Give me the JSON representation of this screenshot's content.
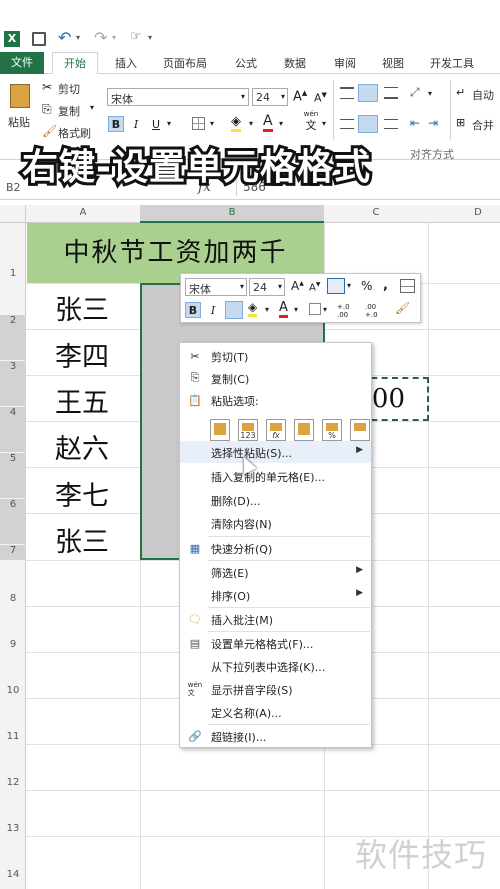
{
  "quick_access": {
    "excel_icon": "excel-logo-icon",
    "save": "save-icon",
    "undo": "undo-icon",
    "redo": "redo-icon",
    "touch": "touch-mode-icon"
  },
  "tabs": [
    {
      "label": "文件"
    },
    {
      "label": "开始"
    },
    {
      "label": "插入"
    },
    {
      "label": "页面布局"
    },
    {
      "label": "公式"
    },
    {
      "label": "数据"
    },
    {
      "label": "审阅"
    },
    {
      "label": "视图"
    },
    {
      "label": "开发工具"
    }
  ],
  "ribbon": {
    "paste": "粘贴",
    "cut": "剪切",
    "copy": "复制",
    "format_painter": "格式刷",
    "font_name": "宋体",
    "font_size": "24",
    "bold": "B",
    "italic": "I",
    "underline": "U",
    "font_color_glyph": "A",
    "wen": "wén",
    "wen_char": "文",
    "auto_wrap": "自动",
    "merge": "合并",
    "align_group": "对齐方式"
  },
  "overlay_title": "右键-设置单元格格式",
  "formula_bar": {
    "name_box": "B2",
    "fx": "fx",
    "value": "586"
  },
  "columns": [
    "A",
    "B",
    "C",
    "D"
  ],
  "rows": [
    "1",
    "2",
    "3",
    "4",
    "5",
    "6",
    "7",
    "8",
    "9",
    "10",
    "11",
    "12",
    "13",
    "14"
  ],
  "sheet": {
    "header": "中秋节工资加两千",
    "names": [
      "张三",
      "李四",
      "王五",
      "赵六",
      "李七",
      "张三"
    ],
    "c4_value": "2000"
  },
  "mini_toolbar": {
    "font_name": "宋体",
    "font_size": "24",
    "percent": "%",
    "comma": ",",
    "dec_inc": "+.0 .00",
    "dec_dec": ".00 +.0"
  },
  "context_menu": [
    {
      "label": "剪切(T)",
      "icon": "scissors-icon"
    },
    {
      "label": "复制(C)",
      "icon": "copy-icon"
    },
    {
      "label": "粘贴选项:",
      "icon": "clipboard-icon"
    },
    {
      "label": "选择性粘贴(S)...",
      "icon": "",
      "submenu": true
    },
    {
      "label": "插入复制的单元格(E)...",
      "icon": ""
    },
    {
      "label": "删除(D)...",
      "icon": ""
    },
    {
      "label": "清除内容(N)",
      "icon": ""
    },
    {
      "label": "快速分析(Q)",
      "icon": "quick-analysis-icon"
    },
    {
      "label": "筛选(E)",
      "icon": "",
      "submenu": true
    },
    {
      "label": "排序(O)",
      "icon": "",
      "submenu": true
    },
    {
      "label": "插入批注(M)",
      "icon": "comment-icon"
    },
    {
      "label": "设置单元格格式(F)...",
      "icon": "format-cells-icon"
    },
    {
      "label": "从下拉列表中选择(K)...",
      "icon": ""
    },
    {
      "label": "显示拼音字段(S)",
      "icon": "phonetic-icon"
    },
    {
      "label": "定义名称(A)...",
      "icon": ""
    },
    {
      "label": "超链接(I)...",
      "icon": "hyperlink-icon"
    }
  ],
  "paste_options": [
    "paste-icon",
    "paste-values-icon",
    "paste-formulas-icon",
    "paste-transpose-icon",
    "paste-formatting-icon",
    "paste-link-icon"
  ],
  "paste_option_labels": [
    "",
    "123",
    "fx",
    "",
    "%",
    ""
  ],
  "watermark": "软件技巧",
  "colors": {
    "file_tab": "#217346",
    "header_fill": "#a9d08e",
    "selection": "#c9c9c9",
    "overlay_text": "#ffffff",
    "overlay_stroke": "#111111"
  }
}
